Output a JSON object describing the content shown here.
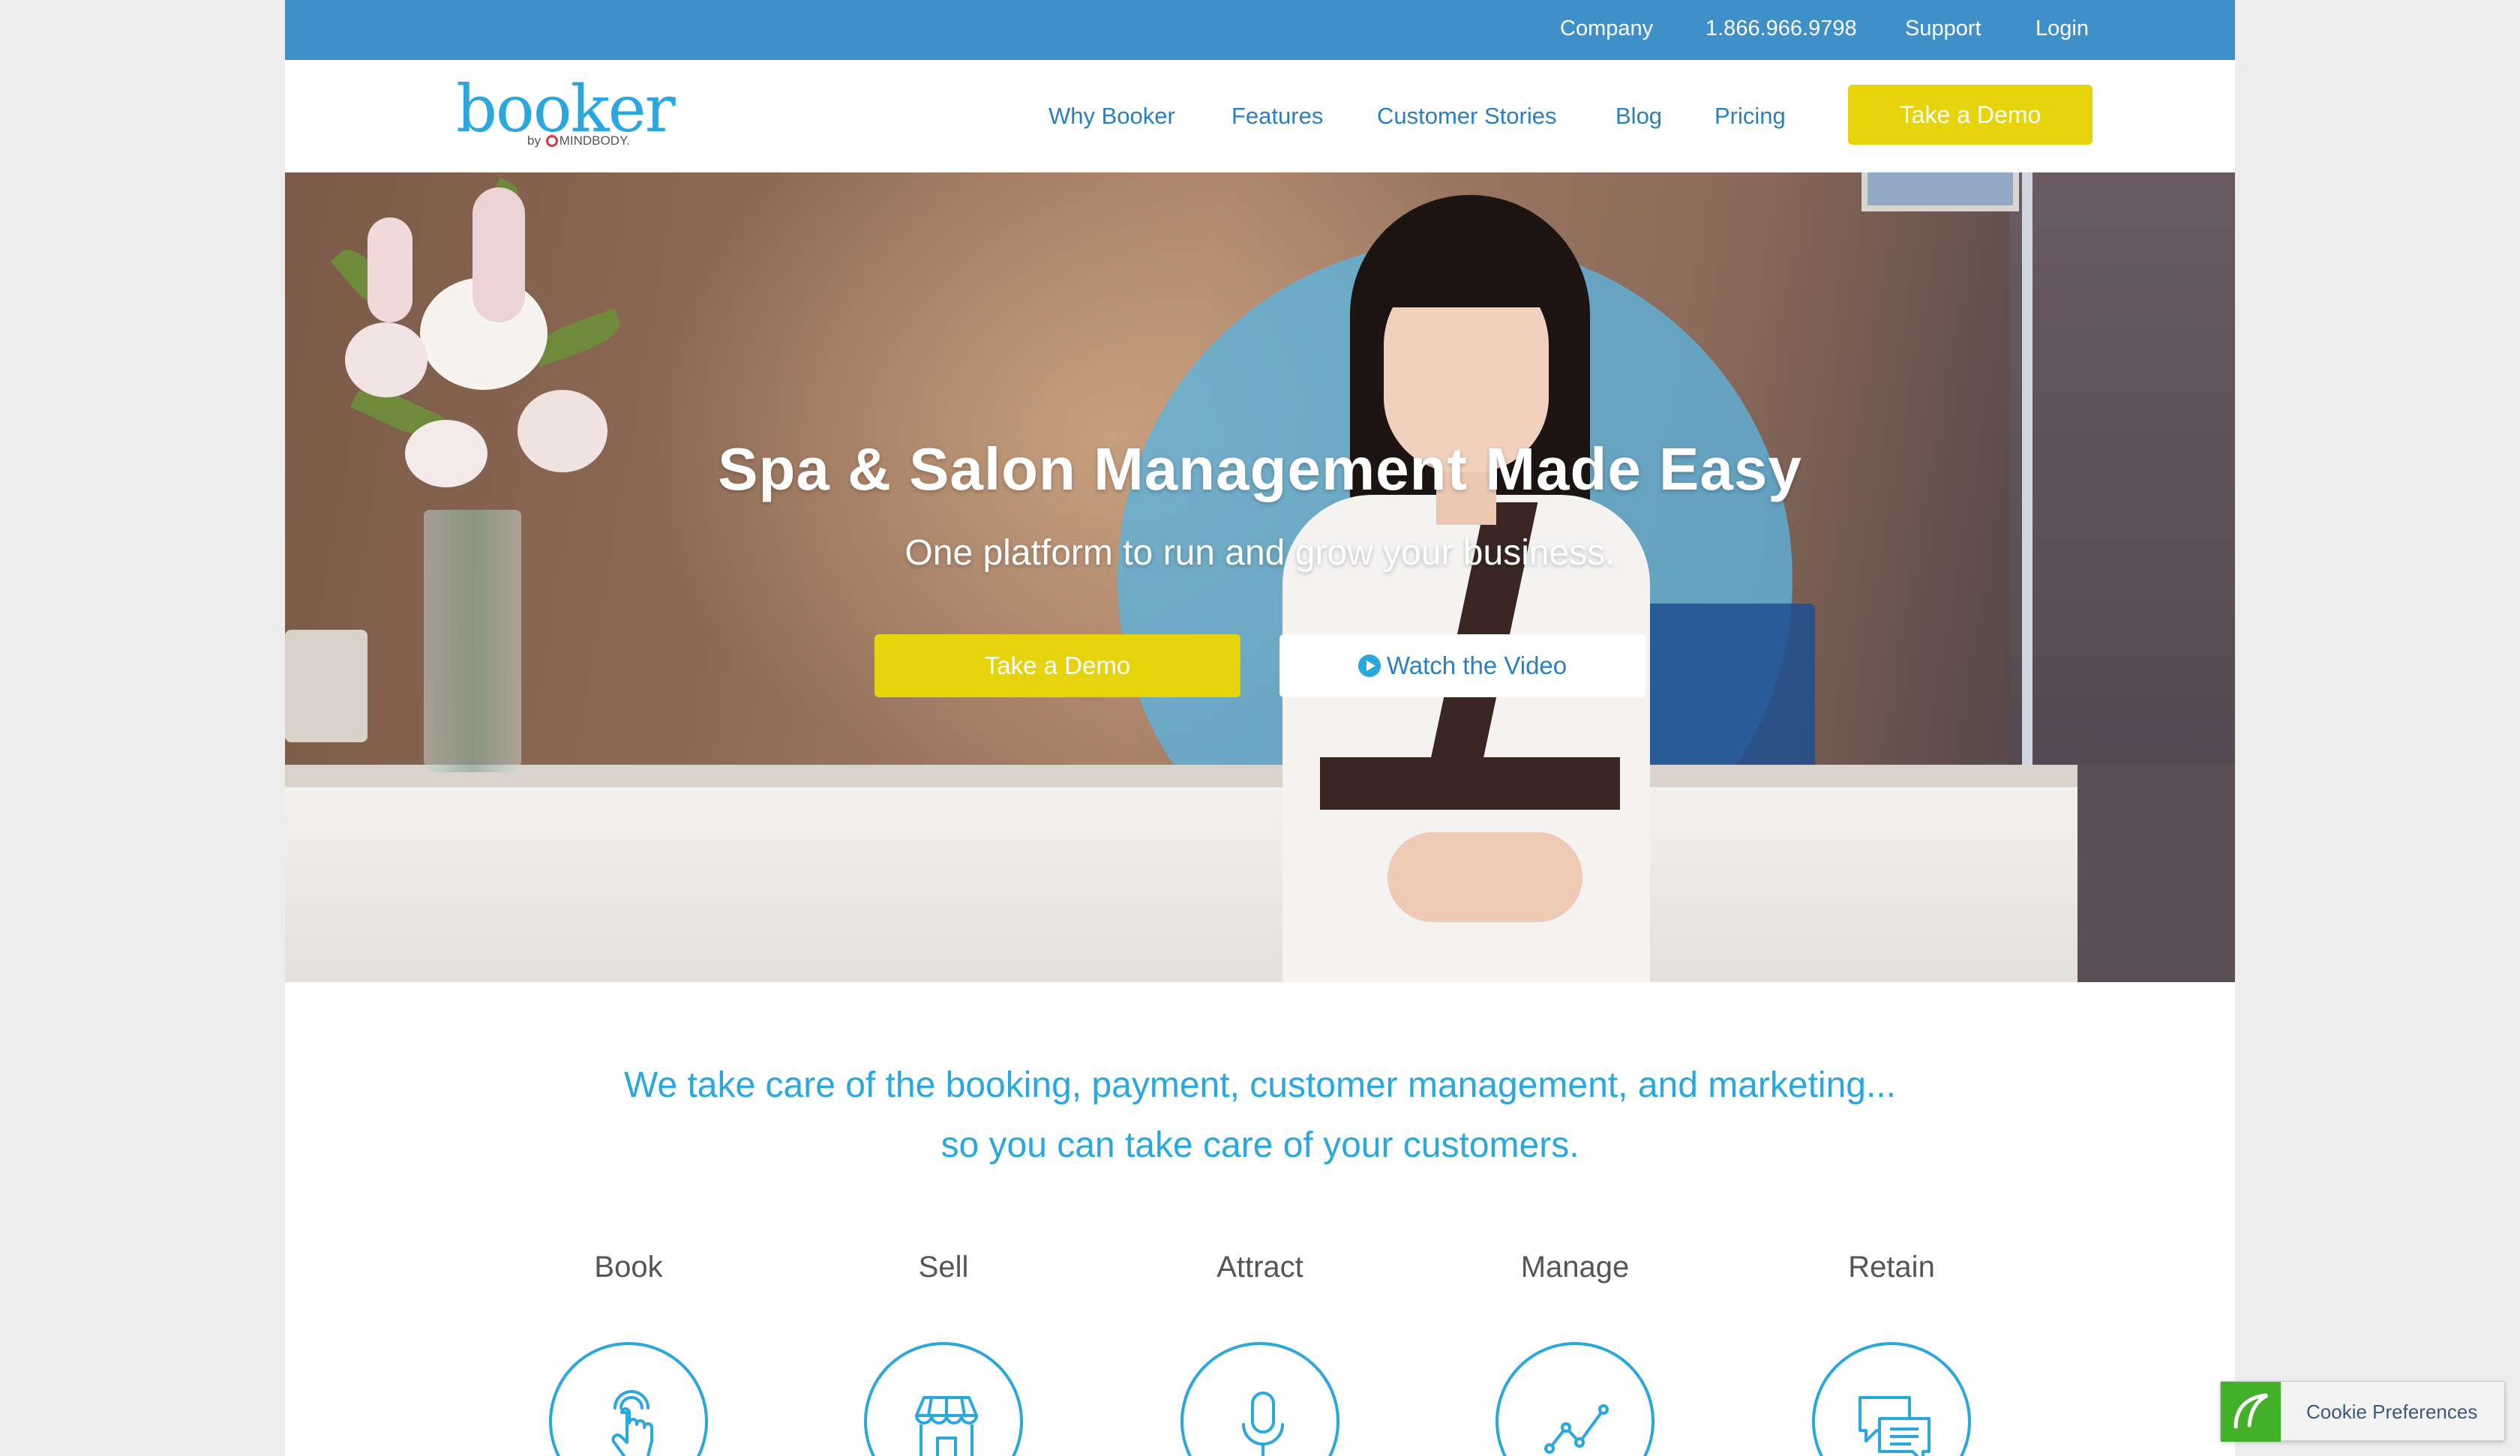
{
  "topbar": {
    "company": "Company",
    "phone": "1.866.966.9798",
    "support": "Support",
    "login": "Login"
  },
  "logo": {
    "word": "booker",
    "by": "by",
    "partner": "MINDBODY."
  },
  "nav": {
    "why": "Why Booker",
    "features": "Features",
    "stories": "Customer Stories",
    "blog": "Blog",
    "pricing": "Pricing",
    "demo": "Take a Demo"
  },
  "hero": {
    "title": "Spa & Salon Management Made Easy",
    "subtitle": "One platform to run and grow your business.",
    "demo_button": "Take a Demo",
    "video_button": "Watch the Video"
  },
  "tagline": {
    "line1": "We take care of the booking, payment, customer management, and marketing...",
    "line2": "so you can take care of your customers."
  },
  "features": [
    {
      "label": "Book",
      "icon": "touch-icon"
    },
    {
      "label": "Sell",
      "icon": "storefront-icon"
    },
    {
      "label": "Attract",
      "icon": "microphone-icon"
    },
    {
      "label": "Manage",
      "icon": "line-chart-icon"
    },
    {
      "label": "Retain",
      "icon": "chat-bubbles-icon"
    }
  ],
  "cookie": {
    "label": "Cookie Preferences"
  },
  "colors": {
    "topbar": "#3f8fc9",
    "accent_blue": "#2aa7dd",
    "link_blue": "#2b7fc0",
    "button_yellow": "#e6d30b",
    "cookie_green": "#43b02a"
  }
}
